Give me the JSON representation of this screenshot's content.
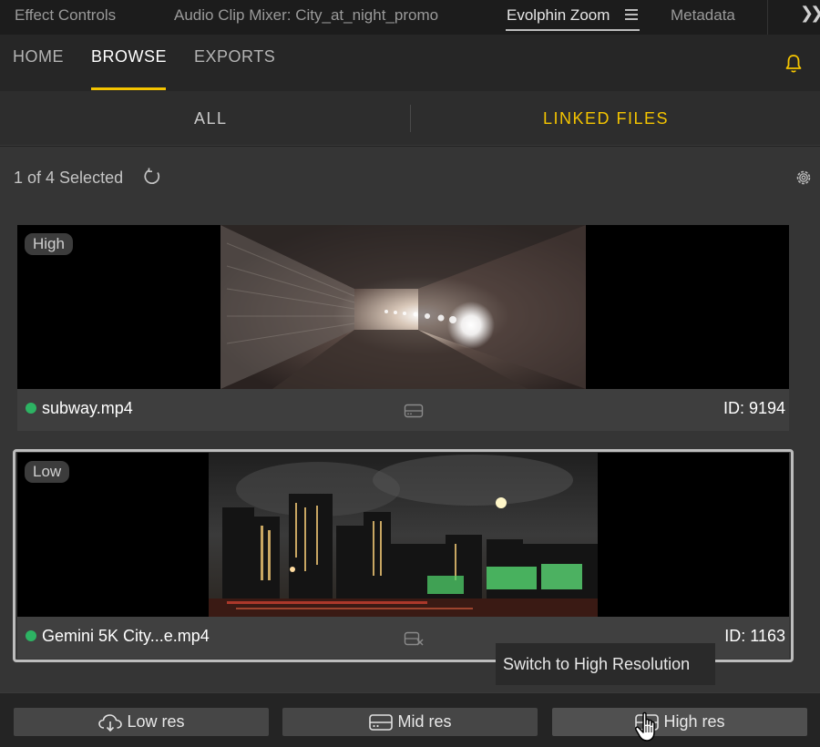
{
  "panel_tabs": [
    {
      "label": "Effect Controls"
    },
    {
      "label": "Audio Clip Mixer: City_at_night_promo"
    },
    {
      "label": "Evolphin Zoom"
    },
    {
      "label": "Metadata"
    }
  ],
  "nav": {
    "items": [
      {
        "label": "HOME"
      },
      {
        "label": "BROWSE"
      },
      {
        "label": "EXPORTS"
      }
    ]
  },
  "subtabs": {
    "all": "ALL",
    "linked": "LINKED FILES"
  },
  "selection": {
    "text": "1 of 4 Selected"
  },
  "files": [
    {
      "badge": "High",
      "name": "subway.mp4",
      "id": "ID: 9194",
      "status_color": "#2db363"
    },
    {
      "badge": "Low",
      "name": "Gemini 5K City...e.mp4",
      "id": "ID: 1163",
      "status_color": "#2db363"
    }
  ],
  "tooltip": "Switch to High Resolution",
  "toolbar": {
    "low": "Low res",
    "mid": "Mid res",
    "high": "High res"
  },
  "colors": {
    "accent": "#f4c400",
    "status_online": "#2db363"
  }
}
